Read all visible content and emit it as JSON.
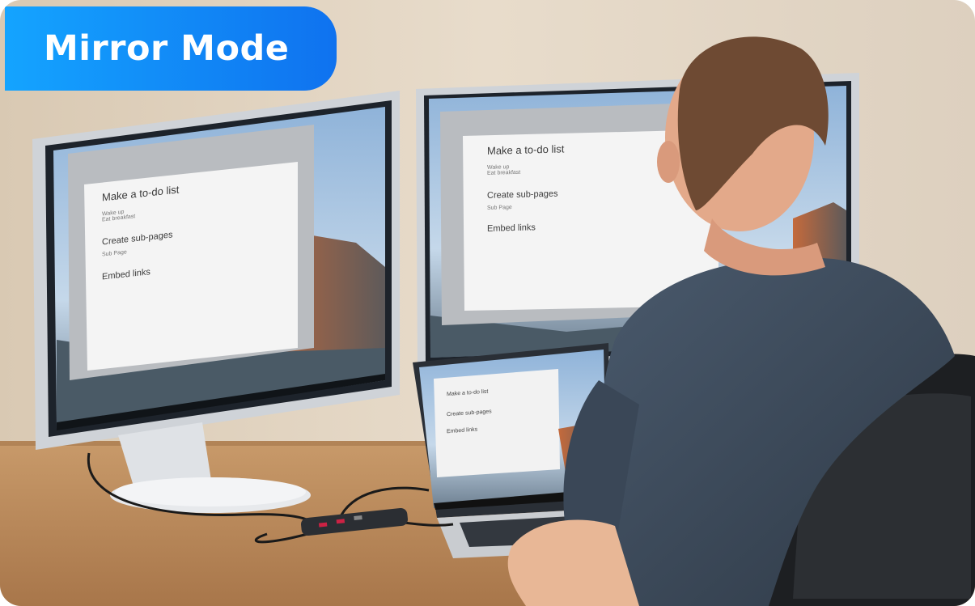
{
  "badge": {
    "label": "Mirror Mode"
  },
  "screens": {
    "left": {
      "todo_title": "Make a to-do list",
      "subpages_title": "Create sub-pages",
      "embed_title": "Embed links",
      "task_1": "Wake up",
      "task_2": "Eat breakfast",
      "subpage_item": "Sub Page"
    },
    "right": {
      "todo_title": "Make a to-do list",
      "subpages_title": "Create sub-pages",
      "embed_title": "Embed links",
      "task_1": "Wake up",
      "task_2": "Eat breakfast",
      "subpage_item": "Sub Page"
    },
    "laptop": {
      "todo_title": "Make a to-do list",
      "subpages_title": "Create sub-pages",
      "embed_title": "Embed links"
    }
  },
  "colors": {
    "badge_start": "#14a4ff",
    "badge_end": "#0f72ef",
    "shirt": "#3e4b5c",
    "desk": "#b98a5a"
  },
  "icons": [
    "windows-logo-icon",
    "search-icon",
    "folder-icon",
    "browser-icon"
  ]
}
